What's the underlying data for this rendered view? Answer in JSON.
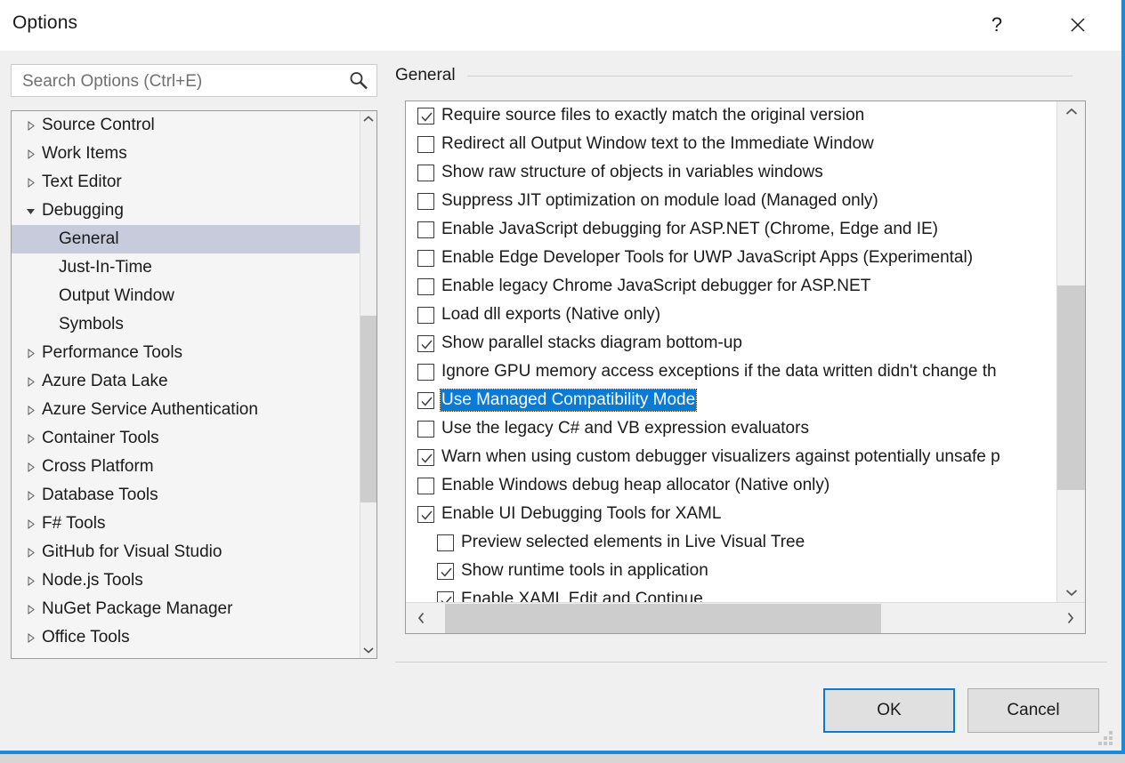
{
  "window": {
    "title": "Options",
    "help_glyph": "?",
    "close_glyph": "✕"
  },
  "search": {
    "placeholder": "Search Options (Ctrl+E)",
    "value": "",
    "icon": "search-icon"
  },
  "tree": {
    "items": [
      {
        "label": "Source Control",
        "level": 0,
        "expander": "collapsed",
        "selected": false
      },
      {
        "label": "Work Items",
        "level": 0,
        "expander": "collapsed",
        "selected": false
      },
      {
        "label": "Text Editor",
        "level": 0,
        "expander": "collapsed",
        "selected": false
      },
      {
        "label": "Debugging",
        "level": 0,
        "expander": "expanded",
        "selected": false
      },
      {
        "label": "General",
        "level": 1,
        "expander": "none",
        "selected": true
      },
      {
        "label": "Just-In-Time",
        "level": 1,
        "expander": "none",
        "selected": false
      },
      {
        "label": "Output Window",
        "level": 1,
        "expander": "none",
        "selected": false
      },
      {
        "label": "Symbols",
        "level": 1,
        "expander": "none",
        "selected": false
      },
      {
        "label": "Performance Tools",
        "level": 0,
        "expander": "collapsed",
        "selected": false
      },
      {
        "label": "Azure Data Lake",
        "level": 0,
        "expander": "collapsed",
        "selected": false
      },
      {
        "label": "Azure Service Authentication",
        "level": 0,
        "expander": "collapsed",
        "selected": false
      },
      {
        "label": "Container Tools",
        "level": 0,
        "expander": "collapsed",
        "selected": false
      },
      {
        "label": "Cross Platform",
        "level": 0,
        "expander": "collapsed",
        "selected": false
      },
      {
        "label": "Database Tools",
        "level": 0,
        "expander": "collapsed",
        "selected": false
      },
      {
        "label": "F# Tools",
        "level": 0,
        "expander": "collapsed",
        "selected": false
      },
      {
        "label": "GitHub for Visual Studio",
        "level": 0,
        "expander": "collapsed",
        "selected": false
      },
      {
        "label": "Node.js Tools",
        "level": 0,
        "expander": "collapsed",
        "selected": false
      },
      {
        "label": "NuGet Package Manager",
        "level": 0,
        "expander": "collapsed",
        "selected": false
      },
      {
        "label": "Office Tools",
        "level": 0,
        "expander": "collapsed",
        "selected": false
      }
    ]
  },
  "content": {
    "header": "General",
    "options": [
      {
        "label": "Require source files to exactly match the original version",
        "checked": true,
        "indent": false,
        "selected": false
      },
      {
        "label": "Redirect all Output Window text to the Immediate Window",
        "checked": false,
        "indent": false,
        "selected": false
      },
      {
        "label": "Show raw structure of objects in variables windows",
        "checked": false,
        "indent": false,
        "selected": false
      },
      {
        "label": "Suppress JIT optimization on module load (Managed only)",
        "checked": false,
        "indent": false,
        "selected": false
      },
      {
        "label": "Enable JavaScript debugging for ASP.NET (Chrome, Edge and IE)",
        "checked": false,
        "indent": false,
        "selected": false
      },
      {
        "label": "Enable Edge Developer Tools for UWP JavaScript Apps (Experimental)",
        "checked": false,
        "indent": false,
        "selected": false
      },
      {
        "label": "Enable legacy Chrome JavaScript debugger for ASP.NET",
        "checked": false,
        "indent": false,
        "selected": false
      },
      {
        "label": "Load dll exports (Native only)",
        "checked": false,
        "indent": false,
        "selected": false
      },
      {
        "label": "Show parallel stacks diagram bottom-up",
        "checked": true,
        "indent": false,
        "selected": false
      },
      {
        "label": "Ignore GPU memory access exceptions if the data written didn't change th",
        "checked": false,
        "indent": false,
        "selected": false
      },
      {
        "label": "Use Managed Compatibility Mode",
        "checked": true,
        "indent": false,
        "selected": true
      },
      {
        "label": "Use the legacy C# and VB expression evaluators",
        "checked": false,
        "indent": false,
        "selected": false
      },
      {
        "label": "Warn when using custom debugger visualizers against potentially unsafe p",
        "checked": true,
        "indent": false,
        "selected": false
      },
      {
        "label": "Enable Windows debug heap allocator (Native only)",
        "checked": false,
        "indent": false,
        "selected": false
      },
      {
        "label": "Enable UI Debugging Tools for XAML",
        "checked": true,
        "indent": false,
        "selected": false
      },
      {
        "label": "Preview selected elements in Live Visual Tree",
        "checked": false,
        "indent": true,
        "selected": false
      },
      {
        "label": "Show runtime tools in application",
        "checked": true,
        "indent": true,
        "selected": false
      },
      {
        "label": "Enable XAML Edit and Continue",
        "checked": true,
        "indent": true,
        "selected": false
      }
    ]
  },
  "footer": {
    "ok_label": "OK",
    "cancel_label": "Cancel"
  },
  "colors": {
    "accent": "#0a7ad6",
    "window_border": "#1c8ad6",
    "selection_blue": "#0a7ad6",
    "tree_selection": "#c7cbdc",
    "scrollbar_thumb": "#cdcdcd",
    "dialog_background": "#f0f0f0"
  }
}
